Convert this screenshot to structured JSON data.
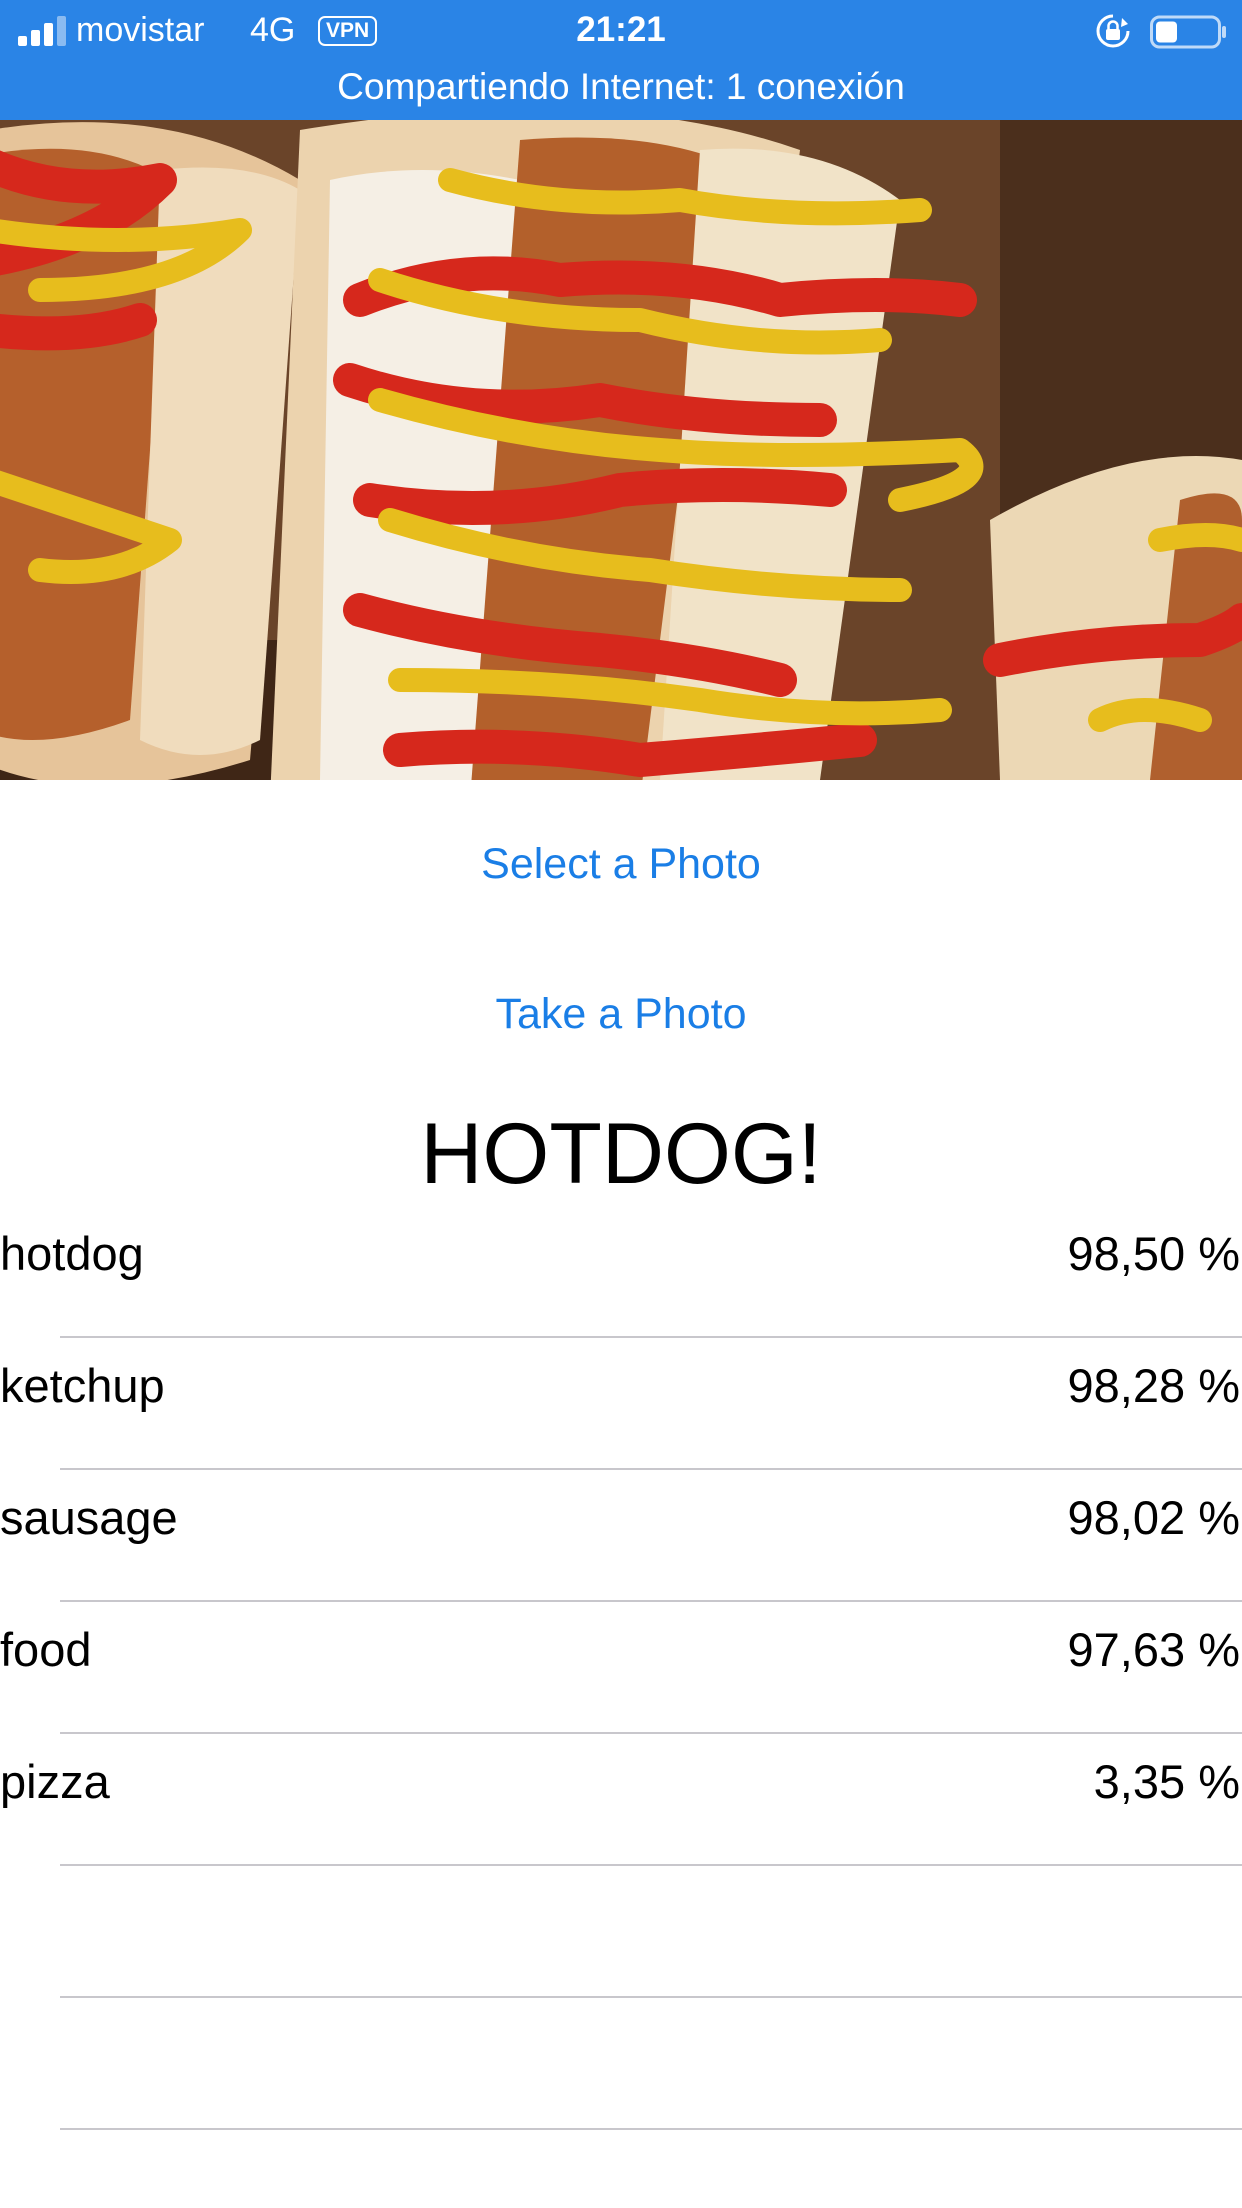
{
  "status_bar": {
    "carrier": "movistar",
    "network": "4G",
    "vpn": "VPN",
    "time": "21:21",
    "hotspot_text": "Compartiendo Internet: 1 conexión",
    "battery_level": 0.35,
    "signal_bars": 3,
    "background_color": "#2a84e6"
  },
  "photo": {
    "icon": "hotdog-photo"
  },
  "actions": {
    "select_photo": "Select a Photo",
    "take_photo": "Take a Photo",
    "accent_color": "#1a7ee6"
  },
  "result": {
    "title": "HOTDOG!"
  },
  "predictions": [
    {
      "label": "hotdog",
      "value": "98,50 %"
    },
    {
      "label": "ketchup",
      "value": "98,28 %"
    },
    {
      "label": "sausage",
      "value": "98,02 %"
    },
    {
      "label": "food",
      "value": "97,63 %"
    },
    {
      "label": "pizza",
      "value": "3,35 %"
    },
    {
      "label": "",
      "value": ""
    },
    {
      "label": "",
      "value": ""
    }
  ]
}
